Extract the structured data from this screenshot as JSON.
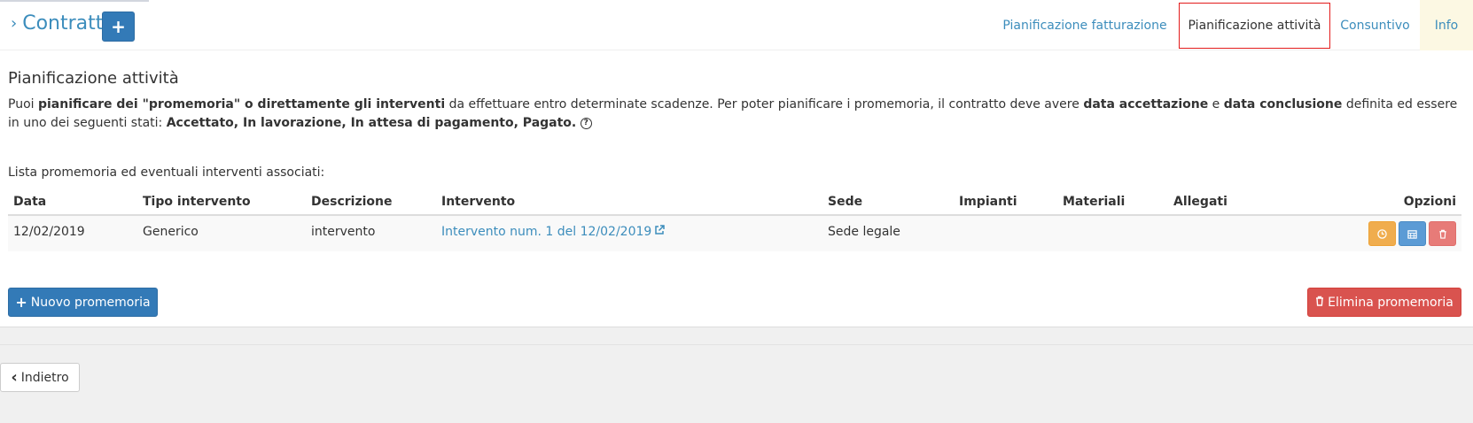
{
  "header": {
    "chevron": "›",
    "title": "Contratti",
    "add_label": "+"
  },
  "tabs": [
    {
      "label": "Pianificazione fatturazione",
      "active": false
    },
    {
      "label": "Pianificazione attività",
      "active": true
    },
    {
      "label": "Consuntivo",
      "active": false
    },
    {
      "label": "Info",
      "active": false
    }
  ],
  "section": {
    "title": "Pianificazione attività",
    "desc": {
      "p1": "Puoi ",
      "b1": "pianificare dei \"promemoria\" o direttamente gli interventi",
      "p2": " da effettuare entro determinate scadenze. Per poter pianificare i promemoria, il contratto deve avere ",
      "b2": "data accettazione",
      "p3": " e ",
      "b3": "data conclusione",
      "p4": " definita ed essere in uno dei seguenti stati: ",
      "b4": "Accettato, In lavorazione, In attesa di pagamento, Pagato.",
      "help_icon": "?"
    },
    "list_label": "Lista promemoria ed eventuali interventi associati:"
  },
  "table": {
    "headers": [
      "Data",
      "Tipo intervento",
      "Descrizione",
      "Intervento",
      "Sede",
      "Impianti",
      "Materiali",
      "Allegati",
      "Opzioni"
    ],
    "rows": [
      {
        "data": "12/02/2019",
        "tipo": "Generico",
        "descrizione": "intervento",
        "intervento": "Intervento num. 1 del 12/02/2019",
        "sede": "Sede legale",
        "impianti": "",
        "materiali": "",
        "allegati": ""
      }
    ]
  },
  "actions": {
    "new_reminder": "Nuovo promemoria",
    "new_reminder_icon": "+",
    "delete_reminders": "Elimina promemoria",
    "back": "Indietro",
    "back_icon": "‹"
  },
  "colors": {
    "primary": "#337ab7",
    "link": "#3c8dbc",
    "danger": "#d9534f",
    "warning": "#f0ad4e",
    "active_tab_border": "#e31b1b",
    "info_tab_bg": "#fcf8e3"
  }
}
